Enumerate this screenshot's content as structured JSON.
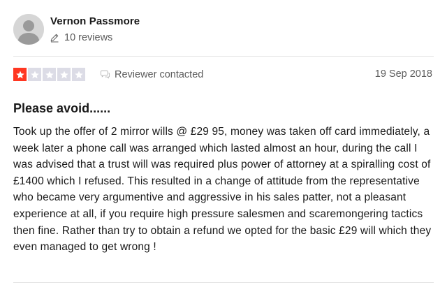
{
  "reviewer": {
    "name": "Vernon Passmore",
    "reviews_count": "10 reviews",
    "avatar_icon": "default-user-avatar",
    "reviews_icon": "pencil-icon"
  },
  "rating": {
    "stars": 1,
    "max": 5,
    "filled_color": "#ff3722",
    "empty_color": "#dcdce6"
  },
  "meta": {
    "contacted_icon": "chat-bubble-icon",
    "contacted_label": "Reviewer contacted",
    "date": "19 Sep 2018"
  },
  "review": {
    "title": "Please avoid......",
    "body": "Took up the offer of 2 mirror wills @ £29 95, money was taken off card immediately, a week later a phone call was arranged which lasted almost an hour, during the call I was advised that a trust will was required plus power of attorney at a spiralling cost of £1400 which I refused. This resulted in a change of attitude from the representative who became very argumentive and aggressive in his sales patter, not a pleasant experience at all, if you require high pressure salesmen and scaremongering tactics then fine. Rather than try to obtain a refund we opted for the basic £29 will which they even managed to get wrong !"
  }
}
